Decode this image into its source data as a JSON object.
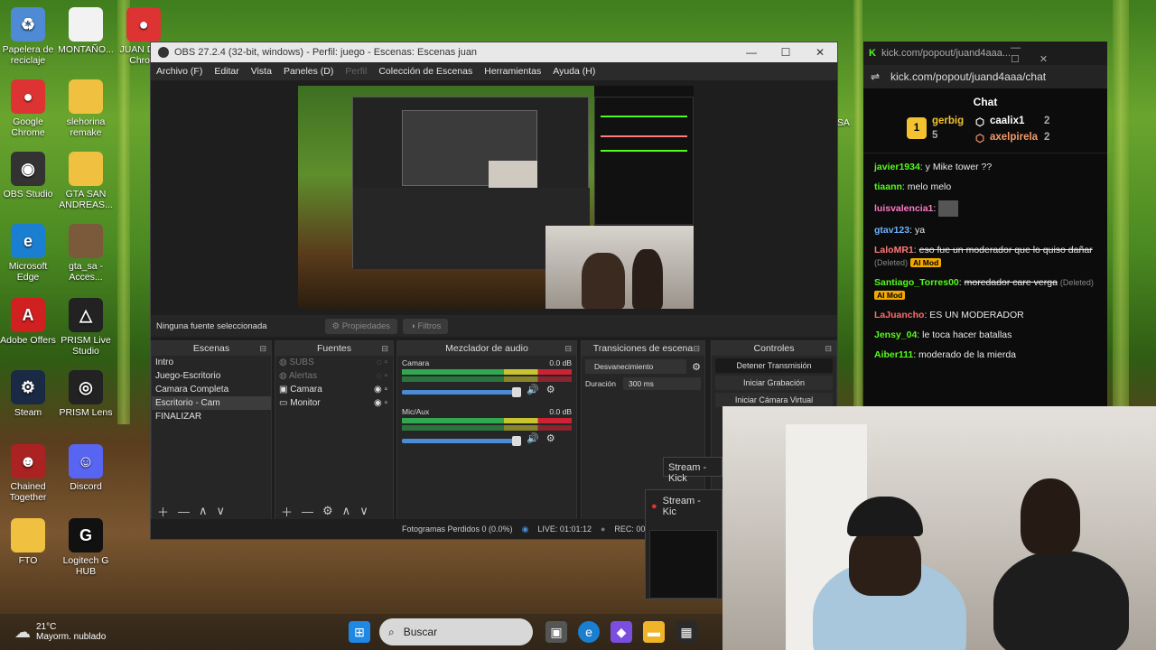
{
  "desktop": {
    "icons": [
      {
        "label": "Papelera de reciclaje",
        "color": "#4e8bd4",
        "glyph": "♻"
      },
      {
        "label": "MONTAÑO...",
        "color": "#f2f2f2",
        "glyph": ""
      },
      {
        "label": "JUAN D... - Chro...",
        "color": "#d33",
        "glyph": "●"
      },
      {
        "label": "Google Chrome",
        "color": "#d33",
        "glyph": "●"
      },
      {
        "label": "slehorina remake",
        "color": "#f0c040",
        "glyph": ""
      },
      {
        "label": "OBS Studio",
        "color": "#333",
        "glyph": "◉"
      },
      {
        "label": "GTA SAN ANDREAS...",
        "color": "#f0c040",
        "glyph": ""
      },
      {
        "label": "Microsoft Edge",
        "color": "#1b7fd1",
        "glyph": "e"
      },
      {
        "label": "gta_sa - Acces...",
        "color": "#7a5a3a",
        "glyph": ""
      },
      {
        "label": "Adobe Offers",
        "color": "#d02020",
        "glyph": "A"
      },
      {
        "label": "PRISM Live Studio",
        "color": "#222",
        "glyph": "△"
      },
      {
        "label": "Steam",
        "color": "#1b2a44",
        "glyph": "⚙"
      },
      {
        "label": "PRISM Lens",
        "color": "#222",
        "glyph": "◎"
      },
      {
        "label": "Chained Together",
        "color": "#a22",
        "glyph": "☻"
      },
      {
        "label": "Discord",
        "color": "#5865f2",
        "glyph": "☺"
      },
      {
        "label": "FTO",
        "color": "#f0c040",
        "glyph": ""
      },
      {
        "label": "Logitech G HUB",
        "color": "#111",
        "glyph": "G"
      }
    ],
    "partial_label": "nSA"
  },
  "obs": {
    "title": "OBS 27.2.4 (32-bit, windows) - Perfil: juego - Escenas: Escenas juan",
    "menu": [
      "Archivo (F)",
      "Editar",
      "Vista",
      "Paneles (D)",
      "Perfil",
      "Colección de Escenas",
      "Herramientas",
      "Ayuda (H)"
    ],
    "no_source": "Ninguna fuente seleccionada",
    "properties": "Propiedades",
    "filters": "Filtros",
    "scenes": {
      "title": "Escenas",
      "items": [
        "Intro",
        "Juego-Escritorio",
        "Camara Completa",
        "Escritorio - Cam",
        "FINALIZAR"
      ],
      "selected": 3
    },
    "sources": {
      "title": "Fuentes",
      "items": [
        {
          "name": "SUBS",
          "dim": true
        },
        {
          "name": "Alertas",
          "dim": true
        },
        {
          "name": "Camara",
          "dim": false
        },
        {
          "name": "Monitor",
          "dim": false
        }
      ]
    },
    "mixer": {
      "title": "Mezclador de audio",
      "channels": [
        {
          "name": "Camara",
          "db": "0.0 dB"
        },
        {
          "name": "Mic/Aux",
          "db": "0.0 dB"
        }
      ]
    },
    "transitions": {
      "title": "Transiciones de escena",
      "type": "Desvanecimiento",
      "duration_label": "Duración",
      "duration": "300 ms"
    },
    "controls": {
      "title": "Controles",
      "buttons": [
        "Detener Transmisión",
        "Iniciar Grabación",
        "Iniciar Cámara Virtual"
      ]
    },
    "status": {
      "dropped": "Fotogramas Perdidos 0 (0.0%)",
      "live": "LIVE: 01:01:12",
      "rec": "REC: 00:00:"
    }
  },
  "chat": {
    "window_title": "kick.com/popout/juand4aaa...",
    "url": "kick.com/popout/juand4aaa/chat",
    "header": "Chat",
    "leaders": [
      {
        "name": "gerbig",
        "count": "5",
        "color": "#f2c230"
      },
      {
        "name": "caalix1",
        "count": "2",
        "color": "#ffffff"
      },
      {
        "name": "axelpirela",
        "count": "2",
        "color": "#f59a6a"
      }
    ],
    "messages": [
      {
        "user": "javier1934",
        "text": "y Mike tower ??",
        "color": "#53fc18"
      },
      {
        "user": "tiaann",
        "text": "melo melo",
        "color": "#53fc18"
      },
      {
        "user": "luisvalencia1",
        "text": "",
        "color": "#ff7ac6"
      },
      {
        "user": "gtav123",
        "text": "ya",
        "color": "#6cb2ff"
      },
      {
        "user": "LaloMR1",
        "text": "eso fue un moderador que lo quiso dañar",
        "deleted": "(Deleted)",
        "tag": "AI Mod",
        "color": "#ff7a7a"
      },
      {
        "user": "Santiago_Torres00",
        "text": "moredador care verga",
        "deleted": "(Deleted)",
        "tag": "AI Mod",
        "color": "#53fc18"
      },
      {
        "user": "LaJuancho",
        "text": "ES UN MODERADOR",
        "color": "#ff6b6b"
      },
      {
        "user": "Jensy_04",
        "text": "le toca hacer batallas",
        "color": "#53fc18"
      },
      {
        "user": "Aiber111",
        "text": "moderado de la mierda",
        "color": "#53fc18"
      }
    ]
  },
  "taskbar": {
    "weather_temp": "21°C",
    "weather_desc": "Mayorm. nublado",
    "search": "Buscar",
    "stream_thumb_1": "Stream - Kick",
    "stream_thumb_2": "Stream - Kic"
  }
}
